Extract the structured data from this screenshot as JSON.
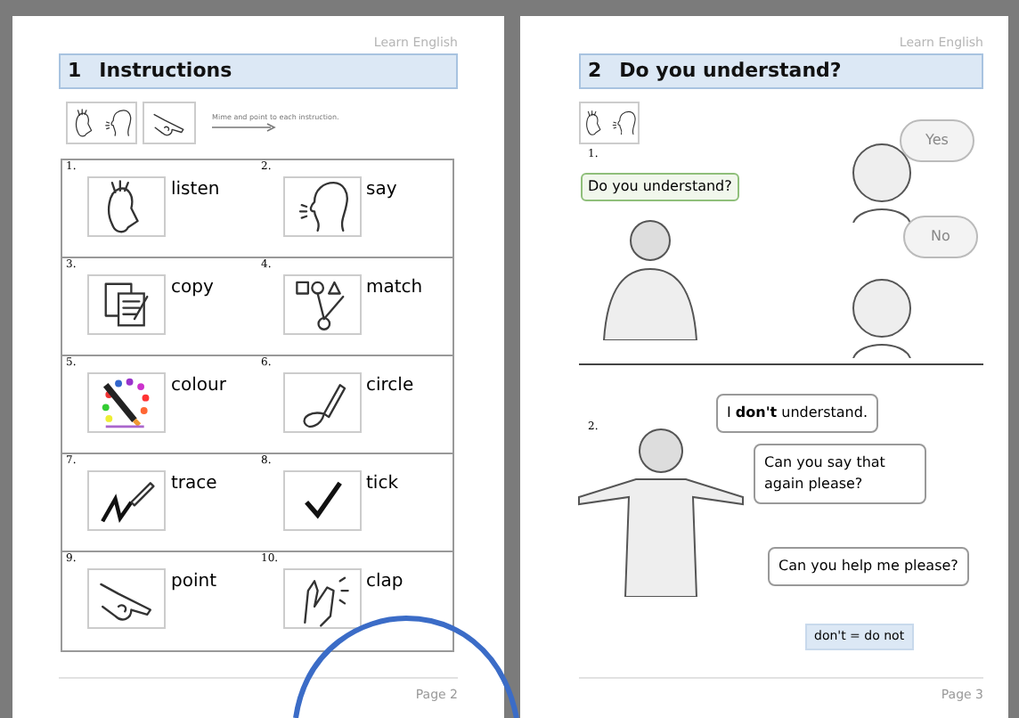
{
  "left_page": {
    "header": "Learn English",
    "title_number": "1",
    "title": "Instructions",
    "instruction": "Mime and point to each instruction.",
    "items": [
      {
        "number": "1.",
        "word": "listen"
      },
      {
        "number": "2.",
        "word": "say"
      },
      {
        "number": "3.",
        "word": "copy"
      },
      {
        "number": "4.",
        "word": "match"
      },
      {
        "number": "5.",
        "word": "colour"
      },
      {
        "number": "6.",
        "word": "circle"
      },
      {
        "number": "7.",
        "word": "trace"
      },
      {
        "number": "8.",
        "word": "tick"
      },
      {
        "number": "9.",
        "word": "point"
      },
      {
        "number": "10.",
        "word": "clap"
      }
    ],
    "footer": "Page 2"
  },
  "right_page": {
    "header": "Learn English",
    "title_number": "2",
    "title": "Do you understand?",
    "scene_1": {
      "number": "1.",
      "question": "Do you understand?",
      "answers": [
        "Yes",
        "No"
      ]
    },
    "scene_2": {
      "number": "2.",
      "bubbles": [
        "I **don't** understand.",
        "Can you say that again please?",
        "Can you help me please?"
      ]
    },
    "note": "don't = do not",
    "footer": "Page 3"
  }
}
